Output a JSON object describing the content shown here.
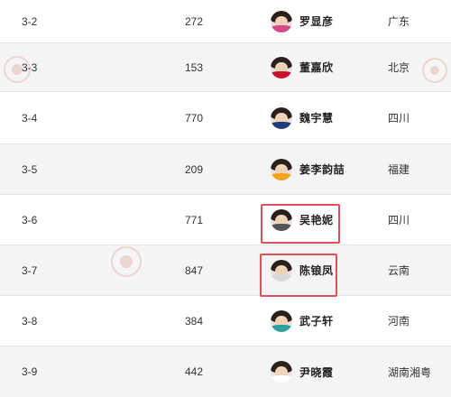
{
  "rows": [
    {
      "code": "3-2",
      "number": "272",
      "name": "罗显彦",
      "region": "广东",
      "shirt_color": "#d44a8a"
    },
    {
      "code": "3-3",
      "number": "153",
      "name": "董嘉欣",
      "region": "北京",
      "shirt_color": "#c8102e"
    },
    {
      "code": "3-4",
      "number": "770",
      "name": "魏宇慧",
      "region": "四川",
      "shirt_color": "#1f3b7a"
    },
    {
      "code": "3-5",
      "number": "209",
      "name": "姜李韵喆",
      "region": "福建",
      "shirt_color": "#f2a321"
    },
    {
      "code": "3-6",
      "number": "771",
      "name": "吴艳妮",
      "region": "四川",
      "shirt_color": "#555555"
    },
    {
      "code": "3-7",
      "number": "847",
      "name": "陈锒凤",
      "region": "云南",
      "shirt_color": "#d8d8d8"
    },
    {
      "code": "3-8",
      "number": "384",
      "name": "武子轩",
      "region": "河南",
      "shirt_color": "#2fa0a0"
    },
    {
      "code": "3-9",
      "number": "442",
      "name": "尹晓霞",
      "region": "湖南湘粤",
      "shirt_color": "#ffffff"
    }
  ],
  "highlight_color": "#e0505c",
  "icons": {
    "avatar": "athlete-photo",
    "watermark": "logo-watermark"
  }
}
